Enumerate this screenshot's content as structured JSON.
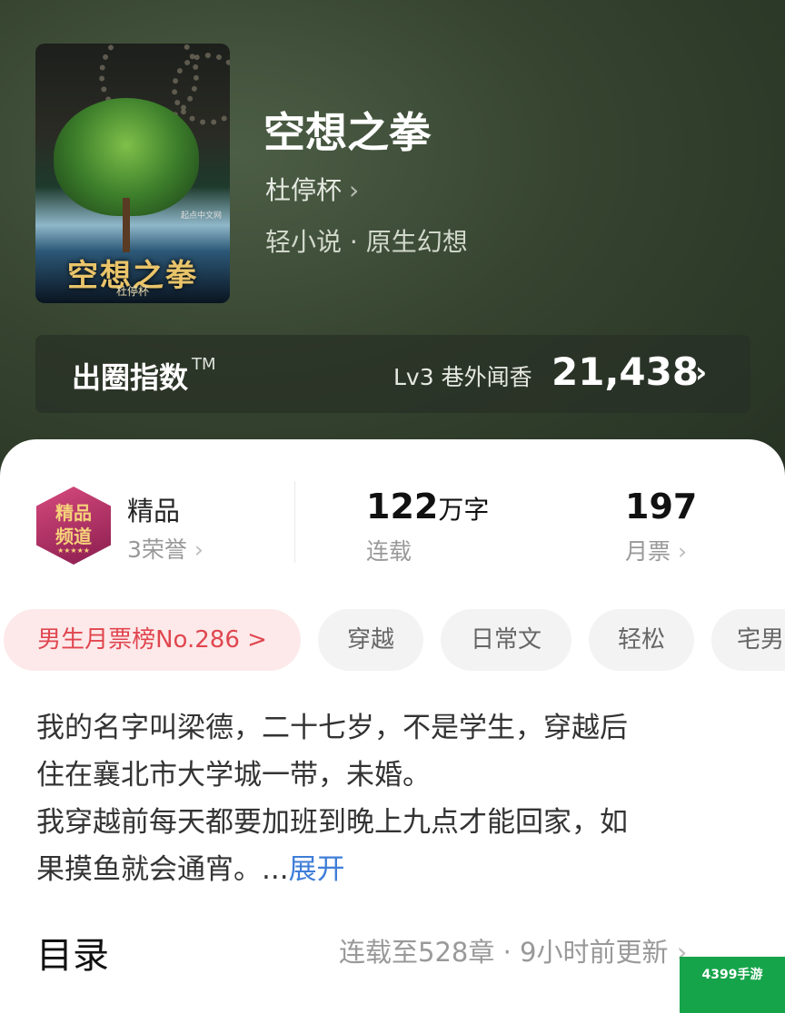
{
  "book": {
    "title": "空想之拳",
    "author": "杜停杯",
    "genre": "轻小说 · 原生幻想",
    "cover": {
      "title": "空想之拳",
      "author": "杜停杯",
      "logo": "起点中文网"
    }
  },
  "index_bar": {
    "label": "出圈指数",
    "trademark": "TM",
    "level": "Lv3 巷外闻香",
    "score": "21,438"
  },
  "stats": {
    "badge_text": "精品频道",
    "quality_label": "精品",
    "honors": "3荣誉",
    "word_count": "122",
    "word_unit": "万字",
    "status": "连载",
    "monthly_tickets": "197",
    "monthly_label": "月票"
  },
  "tags": [
    "男生月票榜No.286 >",
    "穿越",
    "日常文",
    "轻松",
    "宅男"
  ],
  "description": {
    "lines": [
      "我的名字叫梁德，二十七岁，不是学生，穿越后",
      "住在襄北市大学城一带，未婚。",
      "我穿越前每天都要加班到晚上九点才能回家，如",
      "果摸鱼就会通宵。..."
    ],
    "expand": "展开"
  },
  "toc": {
    "title": "目录",
    "status": "连载至528章 · 9小时前更新"
  },
  "watermark": "4399手游",
  "colors": {
    "accent_blue": "#3f7ed8",
    "rank_red": "#e0464f",
    "rank_bg": "#fde9ea"
  }
}
